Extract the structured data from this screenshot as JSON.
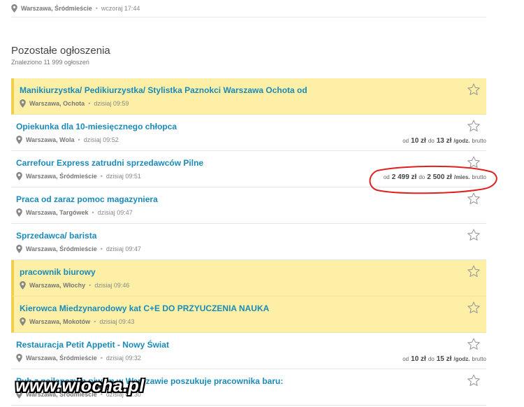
{
  "top_item": {
    "location": "Warszawa, Śródmieście",
    "time": "wczoraj 17:44"
  },
  "section": {
    "title": "Pozostałe ogłoszenia",
    "subtitle": "Znaleziono 11 999 ogłoszeń"
  },
  "listings": [
    {
      "title": "Manikiurzystka/ Pedikiurzystka/ Stylistka Paznokci Warszawa Ochota od",
      "location": "Warszawa, Ochota",
      "time": "dzisiaj 09:59",
      "featured": true
    },
    {
      "title": "Opiekunka dla 10-miesięcznego chłopca",
      "location": "Warszawa, Wola",
      "time": "dzisiaj 09:52",
      "featured": false,
      "salary": {
        "from_label": "od",
        "from": "10 zł",
        "to_label": "do",
        "to": "13 zł",
        "unit": "/godz.",
        "type": "brutto"
      }
    },
    {
      "title": "Carrefour Express zatrudni sprzedawców Pilne",
      "location": "Warszawa, Śródmieście",
      "time": "dzisiaj 09:51",
      "featured": false,
      "salary": {
        "from_label": "od",
        "from": "2 499 zł",
        "to_label": "do",
        "to": "2 500 zł",
        "unit": "/mies.",
        "type": "brutto"
      }
    },
    {
      "title": "Praca od zaraz pomoc magazyniera",
      "location": "Warszawa, Targówek",
      "time": "dzisiaj 09:47",
      "featured": false
    },
    {
      "title": "Sprzedawca/ barista",
      "location": "Warszawa, Śródmieście",
      "time": "dzisiaj 09:47",
      "featured": false
    },
    {
      "title": "pracownik biurowy",
      "location": "Warszawa, Włochy",
      "time": "dzisiaj 09:46",
      "featured": true
    },
    {
      "title": "Kierowca Miedzynarodowy kat C+E DO PRZYUCZENIA NAUKA",
      "location": "Warszawa, Mokotów",
      "time": "dzisiaj 09:43",
      "featured": true
    },
    {
      "title": "Restauracja Petit Appetit - Nowy Świat",
      "location": "Warszawa, Śródmieście",
      "time": "dzisiaj 09:32",
      "featured": false,
      "salary": {
        "from_label": "od",
        "from": "10 zł",
        "to_label": "do",
        "to": "15 zł",
        "unit": "/godz.",
        "type": "brutto"
      }
    },
    {
      "title": "Pub z najlepszym piwem w Warszawie poszukuje pracownika baru:",
      "location": "Warszawa, Śródmieście",
      "time": "dzisiaj 09:30",
      "featured": false
    }
  ],
  "watermark": "www.wiocha.pl",
  "colors": {
    "link": "#1a8ab8",
    "featured_bg": "#fdf0a6",
    "featured_border": "#f2cf4a",
    "annotation": "#e02020"
  }
}
